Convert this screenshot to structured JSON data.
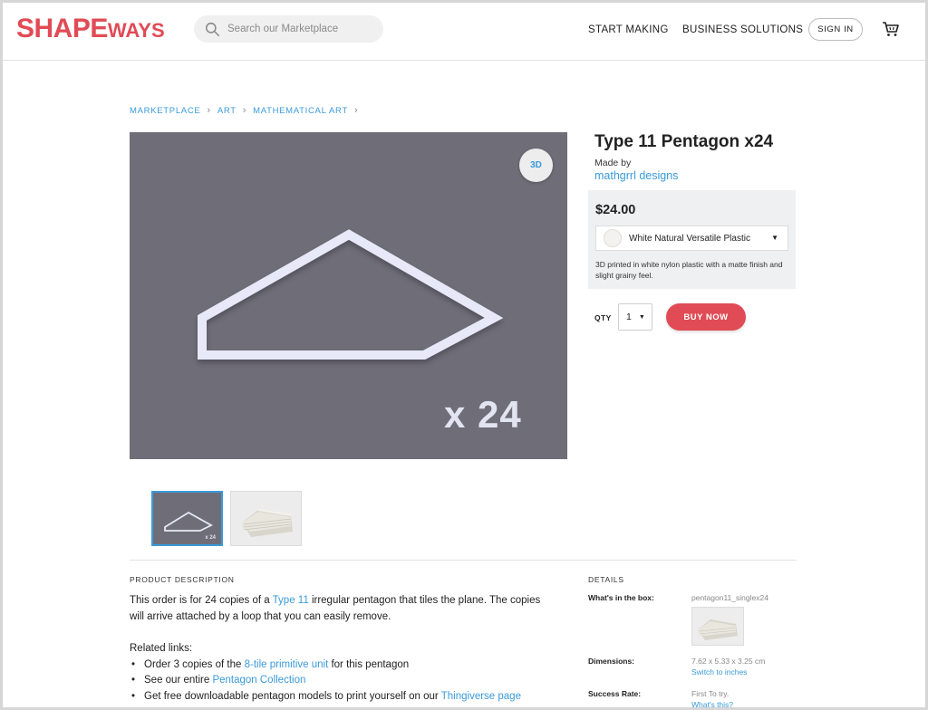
{
  "header": {
    "logo_primary": "SHAPE",
    "logo_secondary": "WAYS",
    "search_placeholder": "Search our Marketplace",
    "nav": [
      "START MAKING",
      "BUSINESS SOLUTIONS"
    ],
    "sign_in": "SIGN IN",
    "brand_color": "#e14b55"
  },
  "breadcrumb": [
    "MARKETPLACE",
    "ART",
    "MATHEMATICAL ART"
  ],
  "gallery": {
    "main_overlay_text": "x 24",
    "badge_label": "3D",
    "thumbnails": [
      {
        "label": "x 24",
        "icon": "pentagon-outline-thumbnail",
        "selected": true
      },
      {
        "label": "",
        "icon": "printed-model-photo-thumbnail",
        "selected": false
      }
    ]
  },
  "product": {
    "title": "Type 11 Pentagon x24",
    "made_by_label": "Made by",
    "designer": "mathgrrl designs",
    "price": "$24.00",
    "material": "White Natural Versatile Plastic",
    "material_description": "3D printed in white nylon plastic with a matte finish and slight grainy feel.",
    "qty_label": "QTY",
    "qty_value": "1",
    "buy_label": "BUY NOW"
  },
  "description": {
    "heading": "PRODUCT DESCRIPTION",
    "p1_a": "This order is for 24 copies of a ",
    "p1_link": "Type 11",
    "p1_b": " irregular pentagon that tiles the plane.  The copies will arrive attached by a loop that you can easily remove.",
    "related_label": "Related links:",
    "related": [
      {
        "a": "Order 3 copies of the ",
        "link": "8-tile primitive unit",
        "b": " for this pentagon"
      },
      {
        "a": "See our entire ",
        "link": "Pentagon Collection",
        "b": ""
      },
      {
        "a": "Get free downloadable pentagon models to print yourself on our ",
        "link": "Thingiverse page",
        "b": ""
      }
    ]
  },
  "details": {
    "heading": "DETAILS",
    "box_label": "What's in the box:",
    "box_value": "pentagon11_singlex24",
    "dimensions_label": "Dimensions:",
    "dimensions_value": "7.62 x 5.33 x 3.25 cm",
    "dimensions_link": "Switch to inches",
    "success_label": "Success Rate:",
    "success_value": "First To try.",
    "success_link": "What's this?"
  }
}
